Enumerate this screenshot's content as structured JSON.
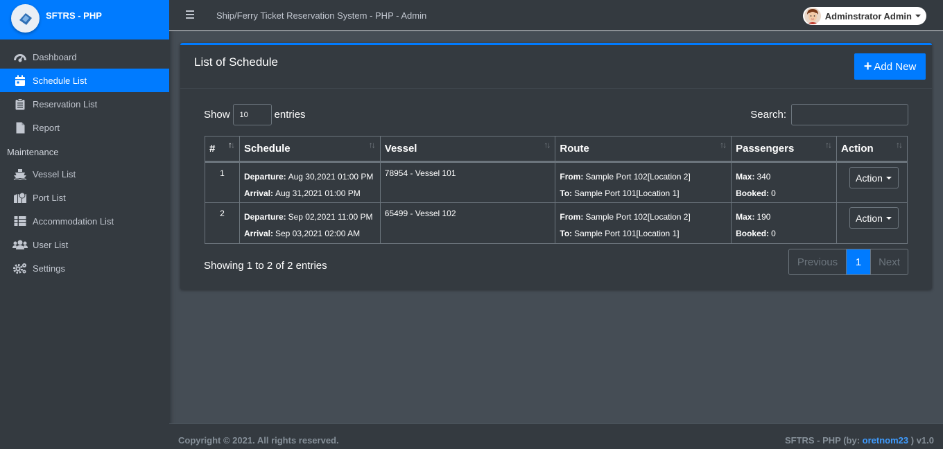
{
  "brand": {
    "name": "SFTRS - PHP"
  },
  "sidebar": {
    "items": [
      {
        "label": "Dashboard",
        "icon": "dashboard-gauge-icon"
      },
      {
        "label": "Schedule List",
        "icon": "calendar-icon",
        "active": true
      },
      {
        "label": "Reservation List",
        "icon": "clipboard-list-icon"
      },
      {
        "label": "Report",
        "icon": "file-icon"
      }
    ],
    "maintenance_header": "Maintenance",
    "maintenance_items": [
      {
        "label": "Vessel List",
        "icon": "ship-icon"
      },
      {
        "label": "Port List",
        "icon": "map-marker-icon"
      },
      {
        "label": "Accommodation List",
        "icon": "list-table-icon"
      },
      {
        "label": "User List",
        "icon": "users-icon"
      },
      {
        "label": "Settings",
        "icon": "gears-icon"
      }
    ]
  },
  "topbar": {
    "title": "Ship/Ferry Ticket Reservation System - PHP - Admin",
    "user_name": "Adminstrator Admin"
  },
  "card": {
    "title": "List of Schedule",
    "add_button": "Add New",
    "show_label": "Show",
    "entries_label": "entries",
    "page_length": "10",
    "search_label": "Search:",
    "search_value": ""
  },
  "table": {
    "headers": [
      "#",
      "Schedule",
      "Vessel",
      "Route",
      "Passengers",
      "Action"
    ],
    "rows": [
      {
        "num": "1",
        "departure_label": "Departure:",
        "departure": "Aug 30,2021 01:00 PM",
        "arrival_label": "Arrival:",
        "arrival": "Aug 31,2021 01:00 PM",
        "vessel": "78954 - Vessel 101",
        "from_label": "From:",
        "from": "Sample Port 102[Location 2]",
        "to_label": "To:",
        "to": "Sample Port 101[Location 1]",
        "max_label": "Max:",
        "max": "340",
        "booked_label": "Booked:",
        "booked": "0",
        "action": "Action"
      },
      {
        "num": "2",
        "departure_label": "Departure:",
        "departure": "Sep 02,2021 11:00 PM",
        "arrival_label": "Arrival:",
        "arrival": "Sep 03,2021 02:00 AM",
        "vessel": "65499 - Vessel 102",
        "from_label": "From:",
        "from": "Sample Port 102[Location 2]",
        "to_label": "To:",
        "to": "Sample Port 101[Location 1]",
        "max_label": "Max:",
        "max": "190",
        "booked_label": "Booked:",
        "booked": "0",
        "action": "Action"
      }
    ]
  },
  "pagination": {
    "info": "Showing 1 to 2 of 2 entries",
    "previous": "Previous",
    "current": "1",
    "next": "Next"
  },
  "footer": {
    "copyright": "Copyright © 2021. All rights reserved.",
    "credit_prefix": "SFTRS - PHP (by: ",
    "credit_author": "oretnom23",
    "credit_suffix": " ) v1.0"
  },
  "colors": {
    "accent": "#007bff",
    "sidebar_bg": "#343a40",
    "content_bg": "#454d55",
    "border": "#6c757d"
  }
}
